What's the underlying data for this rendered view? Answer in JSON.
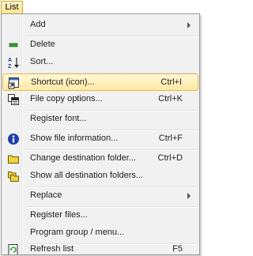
{
  "menubar": {
    "label": "List"
  },
  "menu": {
    "items": [
      {
        "label": "Add",
        "shortcut": "",
        "submenu": true,
        "icon": null
      },
      {
        "label": "Delete",
        "shortcut": "",
        "icon": "delete-icon"
      },
      {
        "label": "Sort...",
        "shortcut": "",
        "icon": "sort-az-icon"
      },
      {
        "label": "Shortcut (icon)...",
        "shortcut": "Ctrl+I",
        "icon": "shortcut-icon",
        "selected": true
      },
      {
        "label": "File copy options...",
        "shortcut": "Ctrl+K",
        "icon": "file-copy-icon"
      },
      {
        "label": "Register font...",
        "shortcut": "",
        "icon": null
      },
      {
        "label": "Show file information...",
        "shortcut": "Ctrl+F",
        "icon": "info-icon"
      },
      {
        "label": "Change destination folder...",
        "shortcut": "Ctrl+D",
        "icon": "folder-icon"
      },
      {
        "label": "Show all destination folders...",
        "shortcut": "",
        "icon": "folders-icon"
      },
      {
        "label": "Replace",
        "shortcut": "",
        "submenu": true,
        "icon": null
      },
      {
        "label": "Register files...",
        "shortcut": "",
        "icon": null
      },
      {
        "label": "Program group / menu...",
        "shortcut": "",
        "icon": null
      },
      {
        "label": "Refresh list",
        "shortcut": "F5",
        "icon": "refresh-icon"
      }
    ]
  },
  "colors": {
    "selected_bg": "#ffe9a3",
    "selected_border": "#e6bb4d",
    "menu_bg": "#f1f1f1"
  }
}
